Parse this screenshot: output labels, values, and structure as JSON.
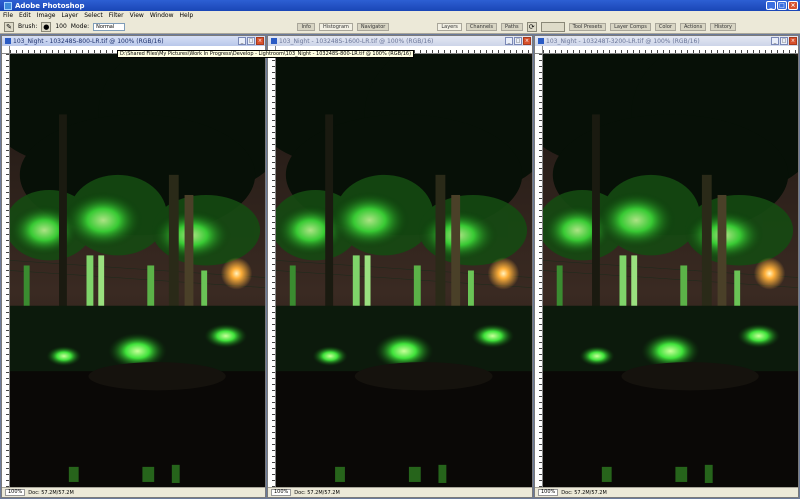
{
  "app": {
    "title": "Adobe Photoshop"
  },
  "menu": [
    "File",
    "Edit",
    "Image",
    "Layer",
    "Select",
    "Filter",
    "View",
    "Window",
    "Help"
  ],
  "options": {
    "brush_label": "Brush:",
    "brush_size": "100",
    "mode_label": "Mode:",
    "mode_value": "Normal"
  },
  "palette_well_left": [
    "Info",
    "Histogram",
    "Navigator"
  ],
  "palette_well_right": [
    "Layers",
    "Channels",
    "Paths"
  ],
  "palette_well_far": [
    "Tool Presets",
    "Layer Comps",
    "Color",
    "Actions",
    "History"
  ],
  "documents": [
    {
      "title": "103_Night - 103248S-800-LR.tif @ 100% (RGB/16)",
      "zoom": "100%",
      "doc_size": "Doc: 57.2M/57.2M"
    },
    {
      "title": "103_Night - 103248S-1600-LR.tif @ 100% (RGB/16)",
      "zoom": "100%",
      "doc_size": "Doc: 57.2M/57.2M"
    },
    {
      "title": "103_Night - 103248T-3200-LR.tif @ 100% (RGB/16)",
      "zoom": "100%",
      "doc_size": "Doc: 57.2M/57.2M"
    }
  ],
  "path_tooltip": "D:\\Shared Files\\My Pictures\\Work In Progress\\Develop - Lightroom\\103_Night - 103248S-800-LR.tif @ 100% (RGB/16)",
  "colors": {
    "titlebar": "#1a46b6",
    "foliage": "#3fe23a",
    "sky": "#3a2a22",
    "streetlight": "#ffb03a"
  }
}
